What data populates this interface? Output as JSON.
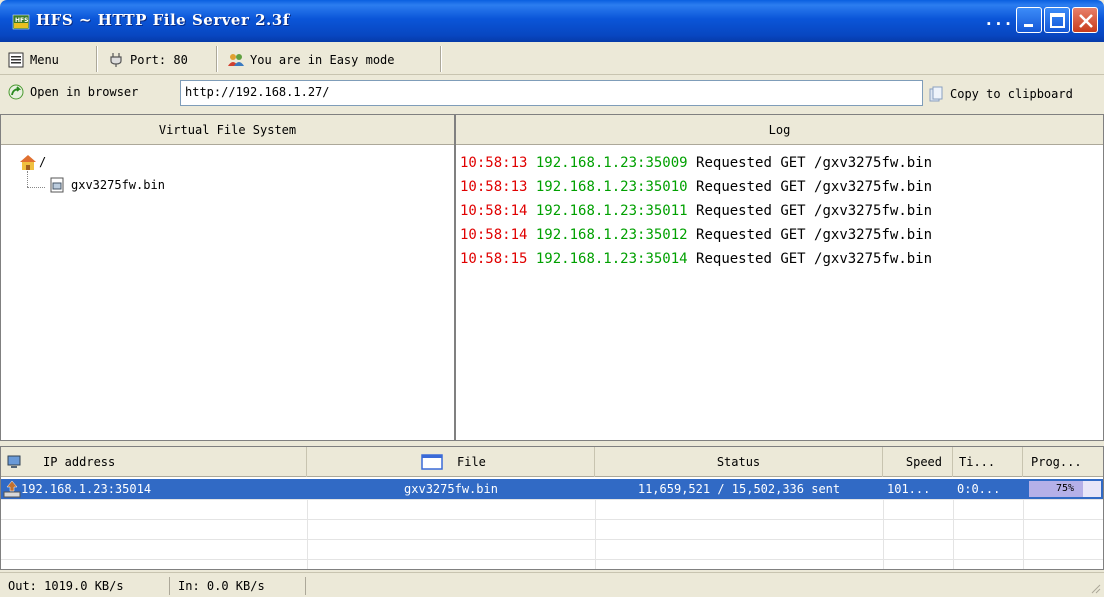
{
  "window": {
    "title": "HFS ~ HTTP File Server 2.3f",
    "dots": "...",
    "colors": {
      "titlebar": "#0a55d8",
      "selection": "#316ac5",
      "log_time": "#e00000",
      "log_addr": "#00a000"
    }
  },
  "toolbar": {
    "menu_label": "Menu",
    "port_label": "Port: 80",
    "mode_label": "You are in Easy mode"
  },
  "urlbar": {
    "open_label": "Open in browser",
    "url_value": "http://192.168.1.27/",
    "copy_label": "Copy to clipboard"
  },
  "vfs": {
    "header": "Virtual File System",
    "root_label": "/",
    "file_label": "gxv3275fw.bin"
  },
  "log": {
    "header": "Log",
    "entries": [
      {
        "time": "10:58:13",
        "addr": "192.168.1.23:35009",
        "message": "Requested GET /gxv3275fw.bin"
      },
      {
        "time": "10:58:13",
        "addr": "192.168.1.23:35010",
        "message": "Requested GET /gxv3275fw.bin"
      },
      {
        "time": "10:58:14",
        "addr": "192.168.1.23:35011",
        "message": "Requested GET /gxv3275fw.bin"
      },
      {
        "time": "10:58:14",
        "addr": "192.168.1.23:35012",
        "message": "Requested GET /gxv3275fw.bin"
      },
      {
        "time": "10:58:15",
        "addr": "192.168.1.23:35014",
        "message": "Requested GET /gxv3275fw.bin"
      }
    ]
  },
  "connections": {
    "columns": {
      "ip": "IP address",
      "file": "File",
      "status": "Status",
      "speed": "Speed",
      "time": "Ti...",
      "progress": "Prog..."
    },
    "rows": [
      {
        "ip": "192.168.1.23:35014",
        "file": "gxv3275fw.bin",
        "status": "11,659,521 / 15,502,336 sent",
        "speed": "101...",
        "time": "0:0...",
        "progress_label": "75%",
        "progress_fraction": 0.75
      }
    ]
  },
  "statusbar": {
    "out_label": "Out: 1019.0 KB/s",
    "in_label": "In: 0.0 KB/s"
  }
}
